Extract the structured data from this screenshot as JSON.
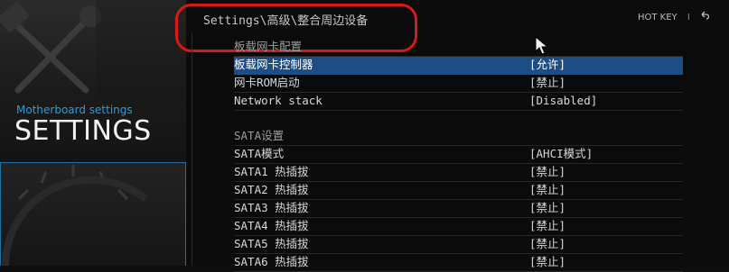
{
  "sidebar": {
    "subtitle": "Motherboard settings",
    "title": "SETTINGS"
  },
  "header": {
    "breadcrumb": "Settings\\高级\\整合周边设备",
    "hotkey_label": "HOT KEY",
    "separator": "I",
    "back_icon": "back-arrow-icon"
  },
  "groups": [
    {
      "header": "板载网卡配置",
      "items": [
        {
          "label": "板载网卡控制器",
          "value": "[允许]",
          "selected": true
        },
        {
          "label": "网卡ROM启动",
          "value": "[禁止]"
        },
        {
          "label": "Network stack",
          "value": "[Disabled]"
        }
      ]
    },
    {
      "header": "SATA设置",
      "items": [
        {
          "label": "SATA模式",
          "value": "[AHCI模式]"
        },
        {
          "label": "SATA1 热插拔",
          "value": "[禁止]"
        },
        {
          "label": "SATA2 热插拔",
          "value": "[禁止]"
        },
        {
          "label": "SATA3 热插拔",
          "value": "[禁止]"
        },
        {
          "label": "SATA4 热插拔",
          "value": "[禁止]"
        },
        {
          "label": "SATA5 热插拔",
          "value": "[禁止]"
        },
        {
          "label": "SATA6 热插拔",
          "value": "[禁止]"
        }
      ]
    }
  ],
  "colors": {
    "accent": "#2f9ad8",
    "selection": "#1e4d86",
    "annotation": "#d61a1a"
  }
}
